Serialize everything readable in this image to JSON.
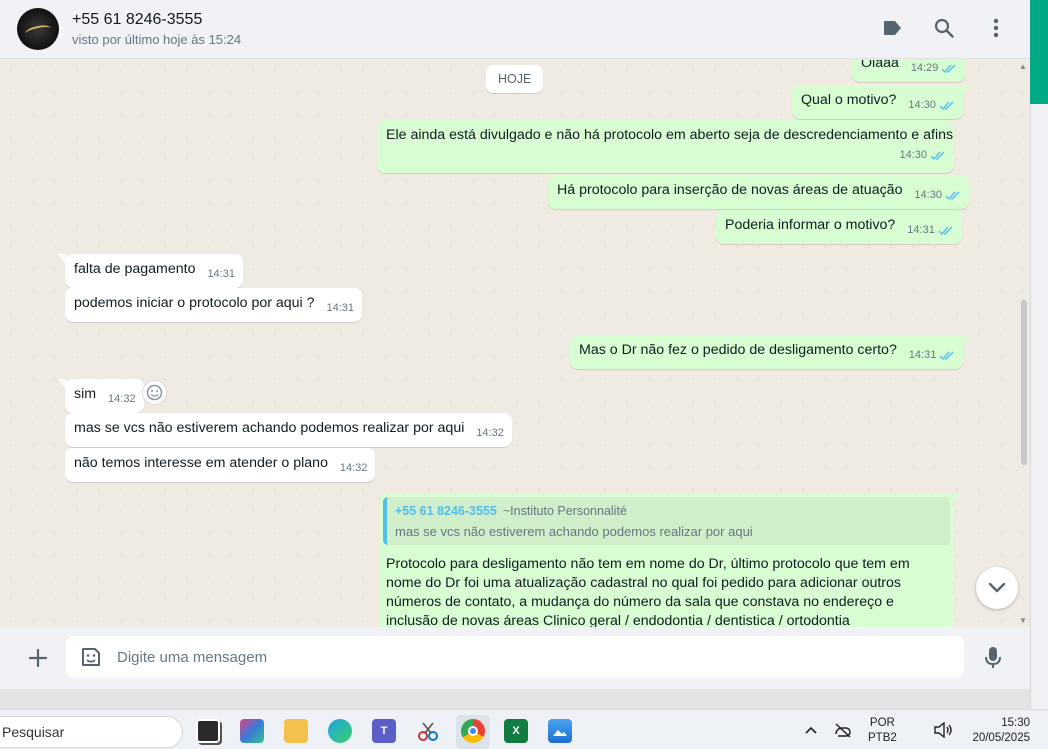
{
  "header": {
    "contact_name": "+55 61 8246-3555",
    "status": "visto por último hoje às 15:24",
    "icons": [
      "label-icon",
      "search-icon",
      "menu-dots-icon"
    ]
  },
  "chat": {
    "date_chip": "HOJE",
    "messages": [
      {
        "dir": "out",
        "text": "Olaaa",
        "time": "14:29"
      },
      {
        "dir": "out",
        "text": "Qual o motivo?",
        "time": "14:30"
      },
      {
        "dir": "out",
        "text": "Ele ainda está divulgado e não há protocolo em aberto seja de descredenciamento e afins",
        "time": "14:30"
      },
      {
        "dir": "out",
        "text": "Há protocolo para inserção de novas áreas de atuação",
        "time": "14:30"
      },
      {
        "dir": "out",
        "text": "Poderia informar o motivo?",
        "time": "14:31"
      },
      {
        "dir": "in",
        "text": "falta de pagamento",
        "time": "14:31"
      },
      {
        "dir": "in",
        "text": "podemos iniciar o protocolo por aqui ?",
        "time": "14:31"
      },
      {
        "dir": "out",
        "text": "Mas o Dr não fez o pedido de desligamento certo?",
        "time": "14:31"
      },
      {
        "dir": "in",
        "text": "sim",
        "time": "14:32"
      },
      {
        "dir": "in",
        "text": "mas se vcs não estiverem achando podemos realizar por aqui",
        "time": "14:32"
      },
      {
        "dir": "in",
        "text": "não temos interesse em atender o plano",
        "time": "14:32"
      }
    ],
    "reply": {
      "quote_author": "+55 61 8246-3555",
      "quote_sub": "~Instituto Personnalité",
      "quote_text": "mas se vcs não estiverem achando podemos realizar por aqui",
      "body": "Protocolo para desligamento não tem em nome do Dr, último protocolo que tem em nome do Dr foi uma atualização cadastral no qual foi pedido para adicionar outros números de contato, a mudança do número da sala que constava no endereço e inclusão de novas áreas Clinico geral / endodontia /  dentistica / ortodontia"
    }
  },
  "composer": {
    "placeholder": "Digite uma mensagem"
  },
  "taskbar": {
    "search_label": "Pesquisar",
    "apps": [
      "file-explorer-icon",
      "copilot-icon",
      "folder-icon",
      "edge-icon",
      "teams-icon",
      "snipping-tool-icon",
      "chrome-icon",
      "excel-icon",
      "photos-icon"
    ],
    "lang_line1": "POR",
    "lang_line2": "PTB2",
    "time": "15:30",
    "date": "20/05/2025"
  },
  "colors": {
    "outgoing_bubble": "#d9fdd3",
    "incoming_bubble": "#ffffff",
    "accent": "#00a884",
    "read_ticks": "#53bdeb"
  }
}
